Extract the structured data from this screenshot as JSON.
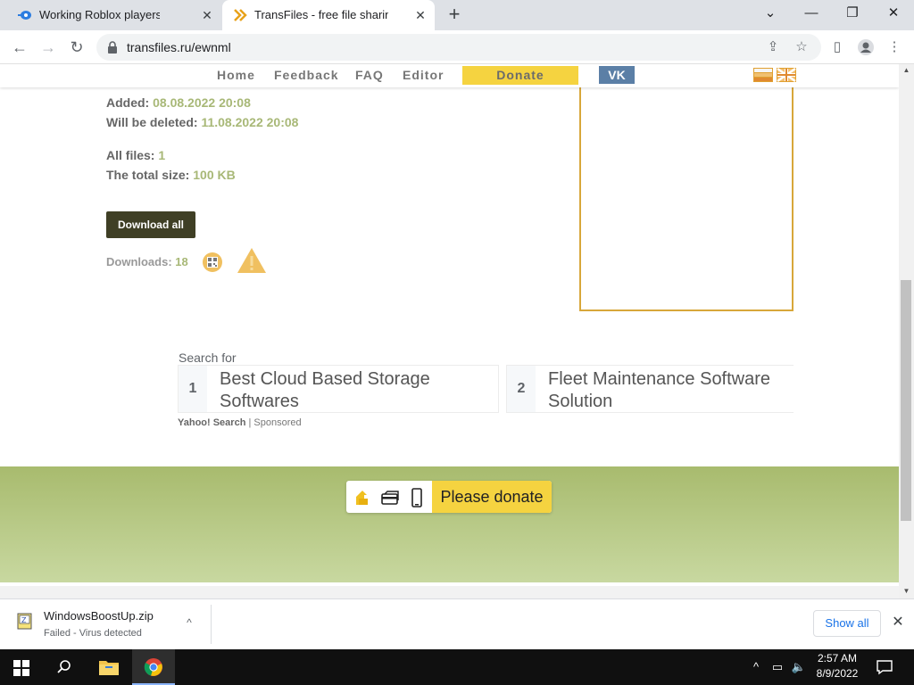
{
  "browser": {
    "tabs": [
      {
        "title": "Working Roblox players"
      },
      {
        "title": "TransFiles - free file sharing service"
      }
    ],
    "url": "transfiles.ru/ewnml"
  },
  "site_nav": {
    "home": "Home",
    "feedback": "Feedback",
    "faq": "FAQ",
    "editor": "Editor",
    "donate": "Donate",
    "vk": "VK"
  },
  "file_info": {
    "added_label": "Added:",
    "added_value": "08.08.2022 20:08",
    "deleted_label": "Will be deleted:",
    "deleted_value": "11.08.2022 20:08",
    "files_label": "All files:",
    "files_value": "1",
    "size_label": "The total size:",
    "size_value": "100 KB",
    "download_all": "Download all",
    "downloads_label": "Downloads:",
    "downloads_value": "18"
  },
  "search_ads": {
    "search_for": "Search for",
    "items": [
      {
        "num": "1",
        "text": "Best Cloud Based Storage Softwares"
      },
      {
        "num": "2",
        "text": "Fleet Maintenance Software Solution"
      }
    ],
    "provider": "Yahoo! Search",
    "sponsored": "Sponsored"
  },
  "banner": {
    "donate": "Please donate"
  },
  "download_shelf": {
    "filename": "WindowsBoostUp.zip",
    "status": "Failed - Virus detected",
    "show_all": "Show all"
  },
  "taskbar": {
    "time": "2:57 AM",
    "date": "8/9/2022"
  },
  "colors": {
    "accent_yellow": "#f5d340",
    "value_green": "#a8b877",
    "banner_green": "#a8bb6e"
  }
}
